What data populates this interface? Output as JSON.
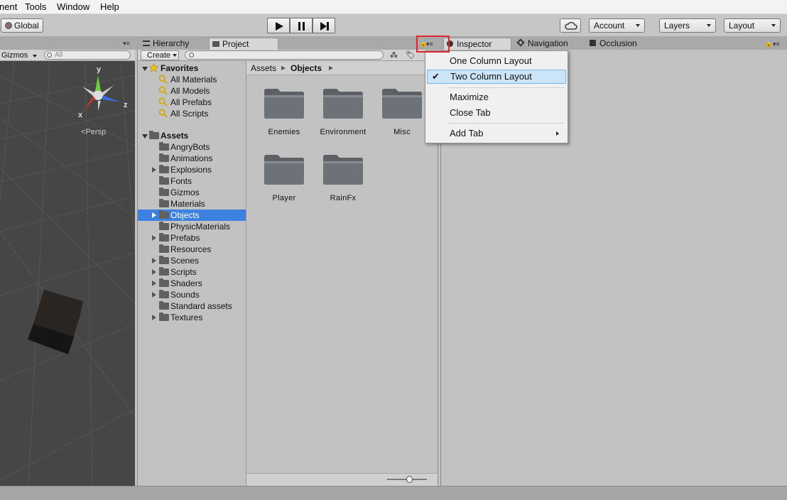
{
  "menubar": {
    "items": [
      "nent",
      "Tools",
      "Window",
      "Help"
    ]
  },
  "toolbar": {
    "global_label": "Global",
    "account_label": "Account",
    "layers_label": "Layers",
    "layout_label": "Layout"
  },
  "tabs": {
    "hierarchy": "Hierarchy",
    "project": "Project",
    "inspector": "Inspector",
    "navigation": "Navigation",
    "occlusion": "Occlusion"
  },
  "scene": {
    "gizmos_label": "Gizmos",
    "search_placeholder": "All",
    "axis_y": "y",
    "axis_x": "x",
    "axis_z": "z",
    "persp_label": "Persp"
  },
  "project": {
    "create_label": "Create",
    "favorites": {
      "title": "Favorites",
      "items": [
        "All Materials",
        "All Models",
        "All Prefabs",
        "All Scripts"
      ]
    },
    "assets": {
      "title": "Assets",
      "items": [
        {
          "label": "AngryBots",
          "expandable": false
        },
        {
          "label": "Animations",
          "expandable": false
        },
        {
          "label": "Explosions",
          "expandable": true
        },
        {
          "label": "Fonts",
          "expandable": false
        },
        {
          "label": "Gizmos",
          "expandable": false
        },
        {
          "label": "Materials",
          "expandable": false
        },
        {
          "label": "Objects",
          "expandable": true,
          "selected": true
        },
        {
          "label": "PhysicMaterials",
          "expandable": false
        },
        {
          "label": "Prefabs",
          "expandable": true
        },
        {
          "label": "Resources",
          "expandable": false
        },
        {
          "label": "Scenes",
          "expandable": true
        },
        {
          "label": "Scripts",
          "expandable": true
        },
        {
          "label": "Shaders",
          "expandable": true
        },
        {
          "label": "Sounds",
          "expandable": true
        },
        {
          "label": "Standard assets",
          "expandable": false
        },
        {
          "label": "Textures",
          "expandable": true
        }
      ]
    },
    "breadcrumb": [
      "Assets",
      "Objects"
    ],
    "folders": [
      "Enemies",
      "Environment",
      "Misc",
      "Player",
      "RainFx"
    ]
  },
  "context_menu": {
    "items": [
      {
        "label": "One Column Layout",
        "checked": false
      },
      {
        "label": "Two Column Layout",
        "checked": true
      },
      {
        "label": "Maximize",
        "checked": false
      },
      {
        "label": "Close Tab",
        "checked": false
      },
      {
        "label": "Add Tab",
        "checked": false,
        "submenu": true
      }
    ]
  },
  "colors": {
    "selection": "#3d80df",
    "highlight_box": "#e0262c",
    "menu_highlight": "#cce4f7"
  }
}
